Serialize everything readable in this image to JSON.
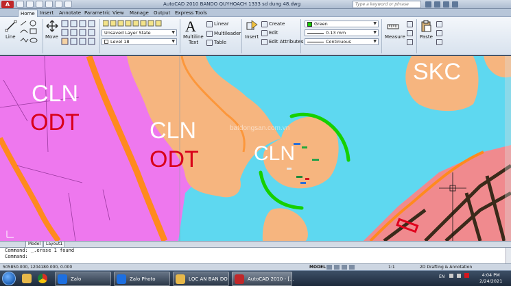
{
  "title_bar": {
    "app_button": "A",
    "title": "AutoCAD 2010    BANDO QUYHOACH 1333 sd dung 48.dwg",
    "search_placeholder": "Type a keyword or phrase"
  },
  "tabs": [
    {
      "label": "Home",
      "active": true
    },
    {
      "label": "Insert"
    },
    {
      "label": "Annotate"
    },
    {
      "label": "Parametric"
    },
    {
      "label": "View"
    },
    {
      "label": "Manage"
    },
    {
      "label": "Output"
    },
    {
      "label": "Express Tools"
    }
  ],
  "ribbon": {
    "draw": {
      "line": "Line"
    },
    "modify": {
      "move": "Move"
    },
    "layers": {
      "state": "Unsaved Layer State",
      "layer": "Level 18"
    },
    "annotation": {
      "text": "Multiline Text",
      "text_line1": "Multiline",
      "text_line2": "Text",
      "linear": "Linear",
      "multileader": "Multileader",
      "table": "Table"
    },
    "block": {
      "insert": "Insert",
      "create": "Create",
      "edit": "Edit",
      "edit_attributes": "Edit Attributes"
    },
    "properties": {
      "color": "Green",
      "lineweight": "0.13 mm",
      "linetype": "Continuous"
    },
    "utilities": {
      "measure": "Measure"
    },
    "clipboard": {
      "paste": "Paste"
    }
  },
  "map_labels": [
    {
      "text": "CLN",
      "color": "#ffffff"
    },
    {
      "text": "ODT",
      "color": "#d8001a"
    },
    {
      "text": "CLN",
      "color": "#ffffff"
    },
    {
      "text": "ODT",
      "color": "#d8001a"
    },
    {
      "text": "CLN",
      "color": "#ffffff"
    },
    {
      "text": "SKC",
      "color": "#ffffff"
    }
  ],
  "layout_tabs": [
    "Model",
    "Layout1"
  ],
  "command_lines": [
    "Command: _.erase 1 found",
    "Command:"
  ],
  "status": {
    "coords": "505850.000, 1204180.000, 0.000",
    "model": "MODEL",
    "scale": "1:1",
    "workspace": "2D Drafting & Annotation"
  },
  "taskbar": {
    "items": [
      {
        "label": "Zalo",
        "color": "#1d6fe0"
      },
      {
        "label": "Zalo Photo",
        "color": "#1d6fe0"
      },
      {
        "label": "LỌC AN BAN DO",
        "color": "#e7b84a"
      },
      {
        "label": "AutoCAD 2010 - [...",
        "color": "#c0282a"
      }
    ],
    "lang": "EN",
    "time": "4:04 PM",
    "date": "2/24/2021"
  },
  "watermark": "batdongsan.com.vn",
  "colors": {
    "pink_zone": "#ee78ee",
    "water": "#5ed8f0",
    "orange_road": "#ff8a1e",
    "peach_zone": "#f6b57f",
    "accent_green": "#16d000"
  }
}
